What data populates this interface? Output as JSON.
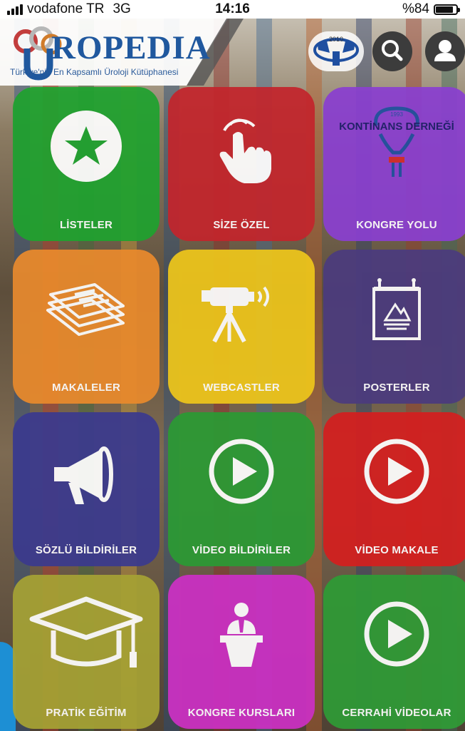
{
  "status_bar": {
    "carrier": "vodafone TR",
    "network": "3G",
    "time": "14:16",
    "battery": "%84"
  },
  "header": {
    "logo_text": "ROPEDIA",
    "logo_tagline": "Türkiye'nin En Kapsamlı Üroloji Kütüphanesi",
    "society_year": "2010"
  },
  "tiles": [
    {
      "label": "LİSTELER",
      "color": "#1fa22f",
      "icon": "star-circle-icon"
    },
    {
      "label": "SİZE ÖZEL",
      "color": "#c3252c",
      "icon": "hand-pointer-icon"
    },
    {
      "label": "KONGRE YOLU",
      "color": "#8a3fd0",
      "icon": "kontinans-logo-icon",
      "logo_text": "KONTİNANS DERNEĞİ",
      "logo_year": "1993"
    },
    {
      "label": "MAKALELER",
      "color": "#e98a2c",
      "icon": "documents-icon"
    },
    {
      "label": "WEBCASTLER",
      "color": "#eec61b",
      "icon": "video-camera-icon"
    },
    {
      "label": "POSTERLER",
      "color": "#4b3b7e",
      "icon": "poster-icon"
    },
    {
      "label": "SÖZLÜ BİLDİRİLER",
      "color": "#3b3a8e",
      "icon": "megaphone-icon"
    },
    {
      "label": "VİDEO BİLDİRİLER",
      "color": "#2b9a34",
      "icon": "play-icon"
    },
    {
      "label": "VİDEO MAKALE",
      "color": "#d41f1f",
      "icon": "play-icon"
    },
    {
      "label": "PRATİK EĞİTİM",
      "color": "#a6a234",
      "icon": "graduation-cap-icon"
    },
    {
      "label": "KONGRE KURSLARI",
      "color": "#cc30c4",
      "icon": "lecturer-icon"
    },
    {
      "label": "CERRAHİ VİDEOLAR",
      "color": "#2f9b36",
      "icon": "play-icon"
    }
  ]
}
